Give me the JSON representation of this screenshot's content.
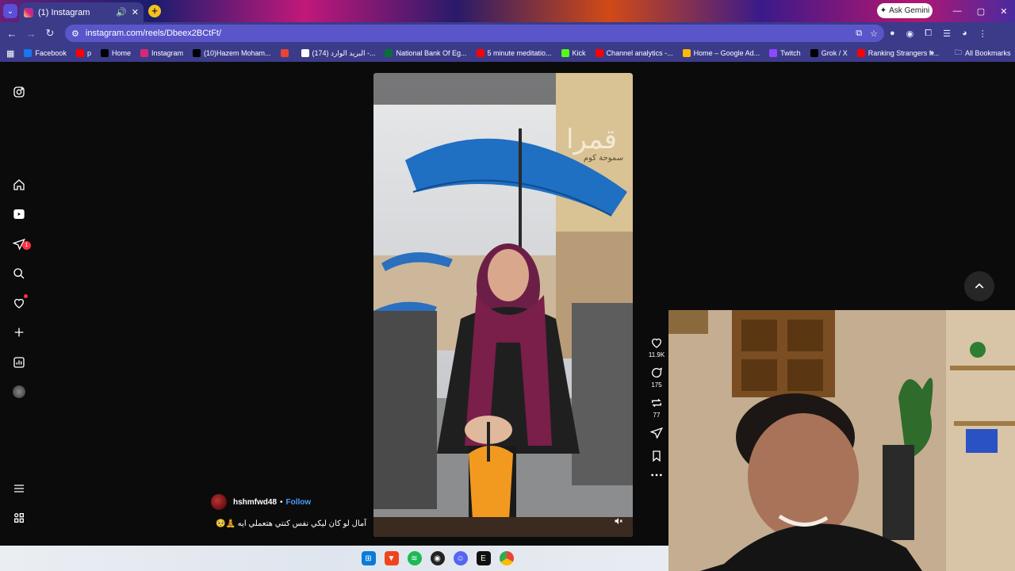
{
  "browser": {
    "tab_title": "(1) Instagram",
    "url": "instagram.com/reels/Dbeex2BCtFt/",
    "ask_gemini": "Ask Gemini",
    "all_bookmarks": "All Bookmarks",
    "bookmarks": [
      {
        "label": "Facebook",
        "color": "#1877f2"
      },
      {
        "label": "p",
        "color": "#ff0000"
      },
      {
        "label": "Home",
        "color": "#000000"
      },
      {
        "label": "Instagram",
        "color": "#d62976"
      },
      {
        "label": "(10)Hazem Moham...",
        "color": "#000000"
      },
      {
        "label": "",
        "color": "#ea4335"
      },
      {
        "label": "(174) البريد الوارد -...",
        "color": "#ffffff"
      },
      {
        "label": "National Bank Of Eg...",
        "color": "#0a6e3c"
      },
      {
        "label": "5 minute meditatio...",
        "color": "#ff0000"
      },
      {
        "label": "Kick",
        "color": "#53fc18"
      },
      {
        "label": "Channel analytics -...",
        "color": "#ff0000"
      },
      {
        "label": "Home – Google Ad...",
        "color": "#fbbc04"
      },
      {
        "label": "Twitch",
        "color": "#9146ff"
      },
      {
        "label": "Grok / X",
        "color": "#000000"
      },
      {
        "label": "Ranking Strangers fr...",
        "color": "#ff0000"
      }
    ]
  },
  "reel": {
    "author": "hshmfwd48",
    "separator": "•",
    "follow_label": "Follow",
    "caption": "آمال لو كان ليكي نفس كنتي هتعملي ايه 🧘🥺",
    "sign_text": "سموحة كوم",
    "likes": "11.9K",
    "comments": "175",
    "reposts": "77"
  },
  "sidebar": {
    "notifications_badge": "1"
  }
}
